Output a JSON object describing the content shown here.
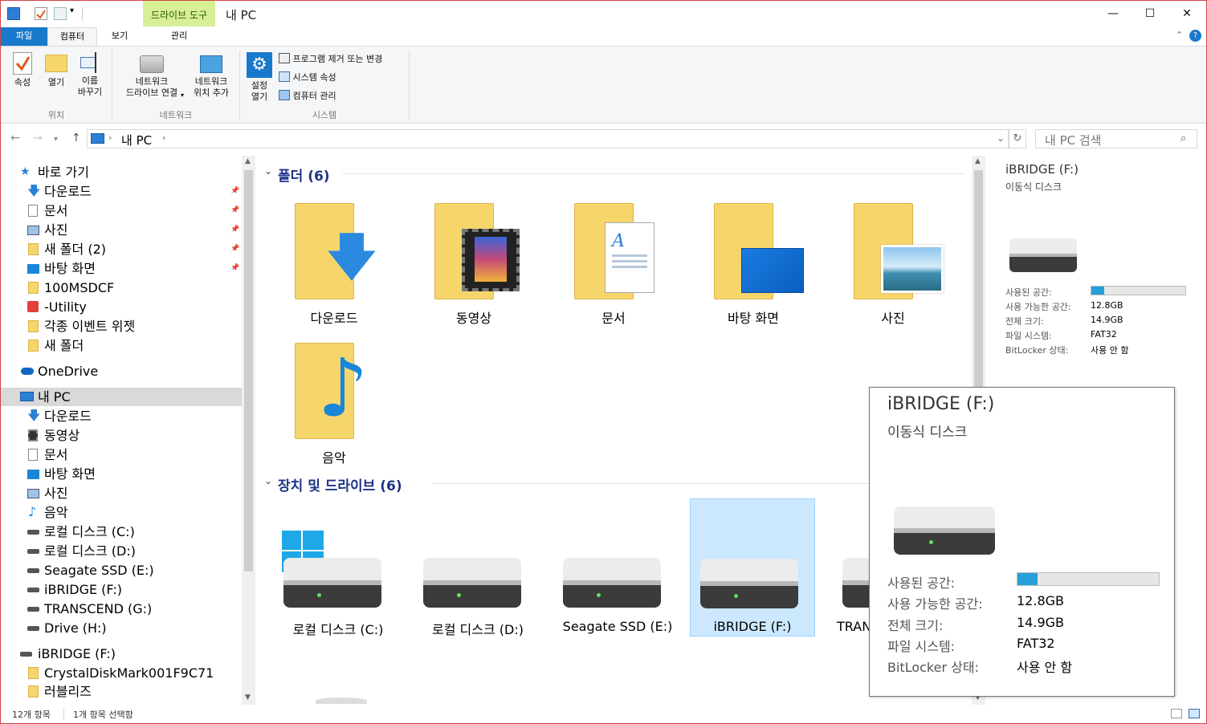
{
  "window": {
    "title": "내 PC",
    "context_tab": "드라이브 도구",
    "minimize": "—",
    "maximize": "☐",
    "close": "✕"
  },
  "tabs": {
    "file": "파일",
    "computer": "컴퓨터",
    "view": "보기",
    "manage": "관리"
  },
  "ribbon": {
    "properties": "속성",
    "open": "열기",
    "rename_1": "이름",
    "rename_2": "바꾸기",
    "group_location": "위치",
    "map_drive_1": "네트워크",
    "map_drive_2": "드라이브 연결",
    "add_loc_1": "네트워크",
    "add_loc_2": "위치 추가",
    "group_network": "네트워크",
    "settings_1": "설정",
    "settings_2": "열기",
    "uninstall": "프로그램 제거 또는 변경",
    "sys_props": "시스템 속성",
    "manage": "컴퓨터 관리",
    "group_system": "시스템"
  },
  "address": {
    "path_root": "내 PC",
    "sep": "›",
    "search_placeholder": "내 PC 검색"
  },
  "nav": {
    "quick_access": "바로 가기",
    "qa_items": [
      "다운로드",
      "문서",
      "사진",
      "새 폴더 (2)",
      "바탕 화면",
      "100MSDCF",
      "-Utility",
      "각종 이벤트 위젯",
      "새 폴더"
    ],
    "onedrive": "OneDrive",
    "this_pc": "내 PC",
    "pc_items": [
      "다운로드",
      "동영상",
      "문서",
      "바탕 화면",
      "사진",
      "음악",
      "로컬 디스크 (C:)",
      "로컬 디스크 (D:)",
      "Seagate SSD (E:)",
      "iBRIDGE (F:)",
      "TRANSCEND (G:)",
      "Drive (H:)"
    ],
    "ibridge": "iBRIDGE (F:)",
    "ib_items": [
      "CrystalDiskMark001F9C71",
      "러블리즈"
    ]
  },
  "content": {
    "folders_header": "폴더 (6)",
    "folders": [
      "다운로드",
      "동영상",
      "문서",
      "바탕 화면",
      "사진",
      "음악"
    ],
    "drives_header": "장치 및 드라이브 (6)",
    "drives": [
      "로컬 디스크 (C:)",
      "로컬 디스크 (D:)",
      "Seagate SSD (E:)",
      "iBRIDGE (F:)",
      "TRAN"
    ]
  },
  "details": {
    "name": "iBRIDGE (F:)",
    "type": "이동식 디스크",
    "used_label": "사용된 공간:",
    "free_label": "사용 가능한 공간:",
    "free_value": "12.8GB",
    "total_label": "전체 크기:",
    "total_value": "14.9GB",
    "fs_label": "파일 시스템:",
    "fs_value": "FAT32",
    "bitlocker_label": "BitLocker 상태:",
    "bitlocker_value": "사용 안 함",
    "used_fraction": 0.14
  },
  "status": {
    "count": "12개 항목",
    "selected": "1개 항목 선택함"
  },
  "colors": {
    "accent": "#1979ca",
    "selection": "#cce8ff",
    "folder": "#f6d66b",
    "header": "#1e3287"
  }
}
